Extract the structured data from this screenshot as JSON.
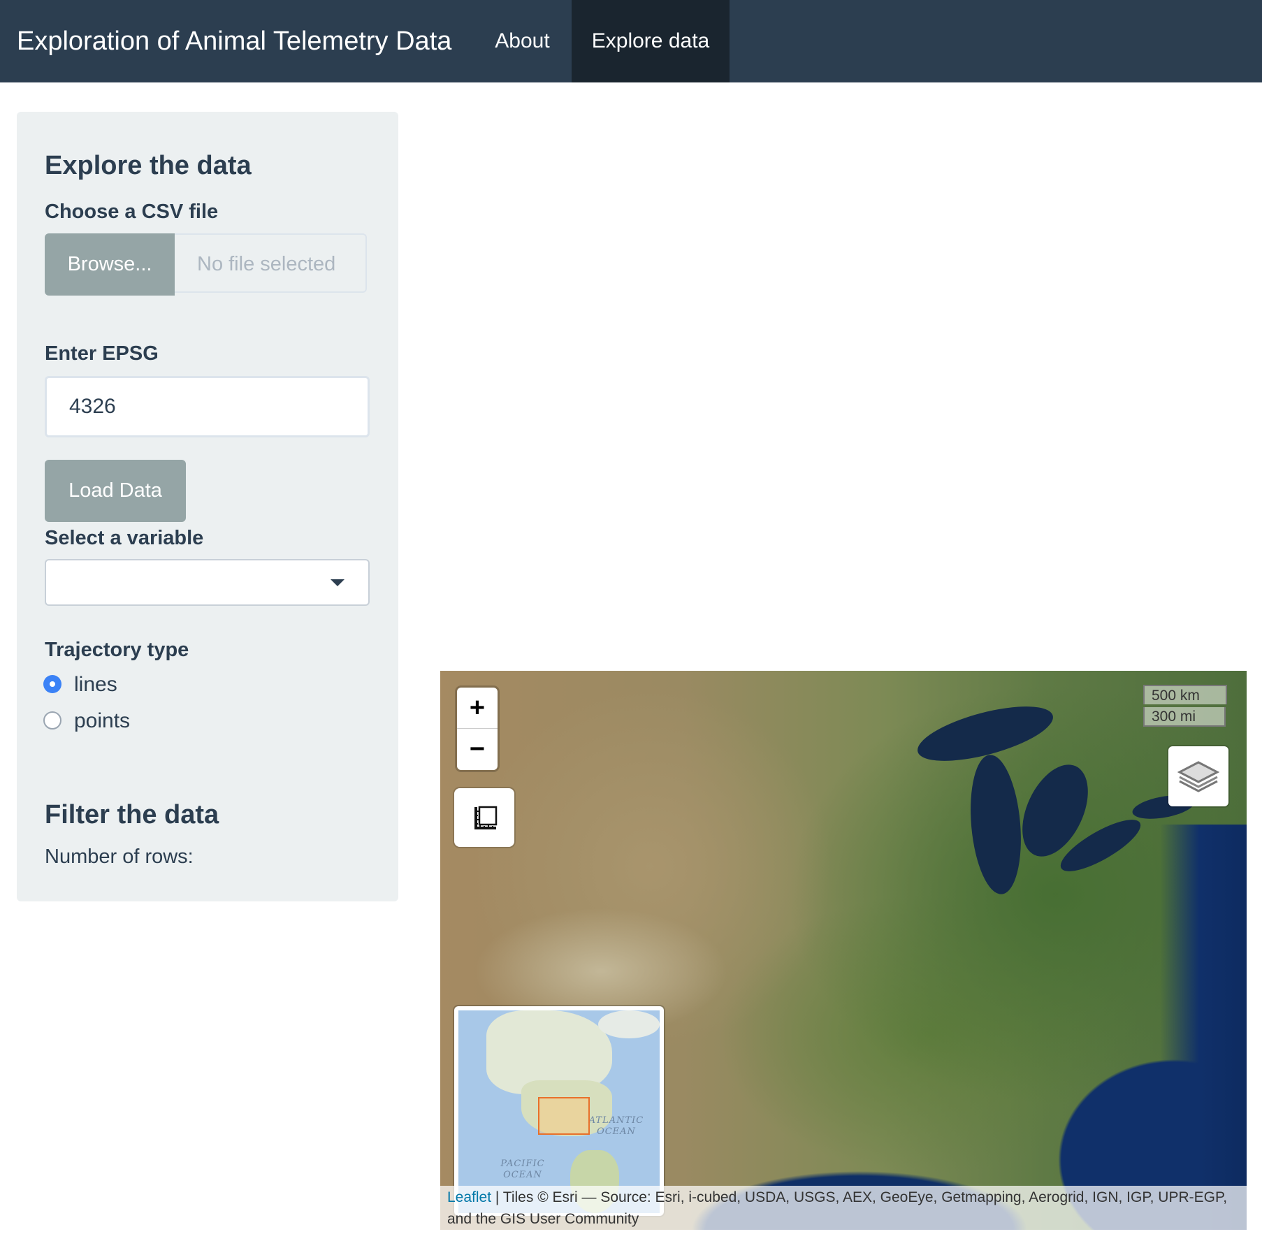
{
  "navbar": {
    "brand": "Exploration of Animal Telemetry Data",
    "items": [
      {
        "label": "About"
      },
      {
        "label": "Explore data",
        "active": true
      }
    ]
  },
  "sidebar": {
    "heading": "Explore the data",
    "file_input": {
      "label": "Choose a CSV file",
      "button": "Browse...",
      "placeholder": "No file selected"
    },
    "epsg": {
      "label": "Enter EPSG",
      "value": "4326"
    },
    "load_button": "Load Data",
    "variable_select": {
      "label": "Select a variable",
      "value": ""
    },
    "trajectory": {
      "label": "Trajectory type",
      "options": [
        {
          "label": "lines",
          "checked": true
        },
        {
          "label": "points",
          "checked": false
        }
      ]
    },
    "filter_heading": "Filter the data",
    "rows_label": "Number of rows:"
  },
  "map": {
    "zoom_in": "+",
    "zoom_out": "−",
    "scale_km": "500 km",
    "scale_mi": "300 mi",
    "minimap_labels": {
      "atlantic": "ATLANTIC OCEAN",
      "pacific": "PACIFIC OCEAN"
    },
    "attribution": {
      "link": "Leaflet",
      "text": " | Tiles © Esri — Source: Esri, i-cubed, USDA, USGS, AEX, GeoEye, Getmapping, Aerogrid, IGN, IGP, UPR-EGP, and the GIS User Community"
    }
  },
  "icons": {
    "measure": "ruler-icon",
    "layers": "layers-icon",
    "dropdown": "caret-down-icon"
  },
  "colors": {
    "navbar": "#2c3e50",
    "navbar_active": "#1a252f",
    "sidebar_bg": "#ecf0f1",
    "button_gray": "#95a5a6",
    "radio_checked": "#3b82f6",
    "minimap_extent": "#e8702a",
    "leaflet_link": "#0078a8"
  }
}
